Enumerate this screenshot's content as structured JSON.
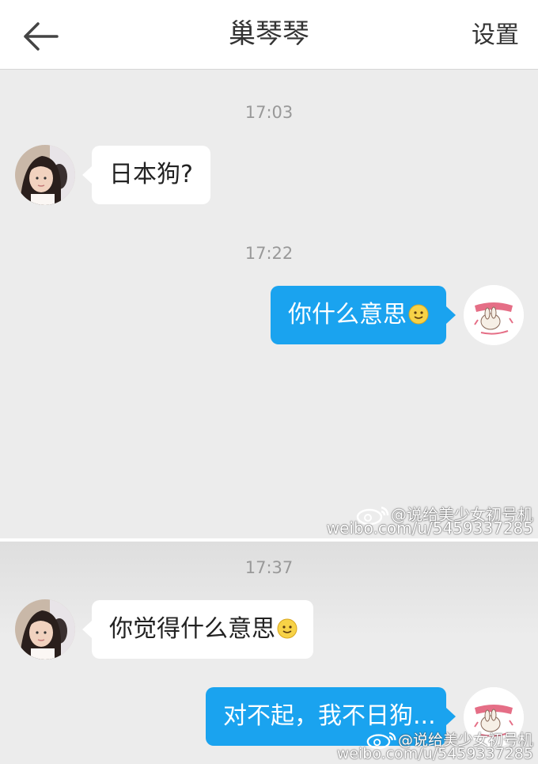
{
  "header": {
    "title": "巢琴琴",
    "settings_label": "设置"
  },
  "messages": [
    {
      "time": "17:03",
      "side": "in",
      "text": "日本狗?"
    },
    {
      "time": "17:22",
      "side": "out",
      "text": "你什么意思"
    },
    {
      "time": "17:37",
      "side": "in",
      "text": "你觉得什么意思"
    },
    {
      "side": "out",
      "text": "对不起，我不日狗..."
    }
  ],
  "watermark": {
    "handle": "@说给美少女初号机",
    "url": "weibo.com/u/5459337285"
  },
  "colors": {
    "outgoing_bubble": "#1aa3ef",
    "incoming_bubble": "#ffffff",
    "background": "#ececec"
  }
}
